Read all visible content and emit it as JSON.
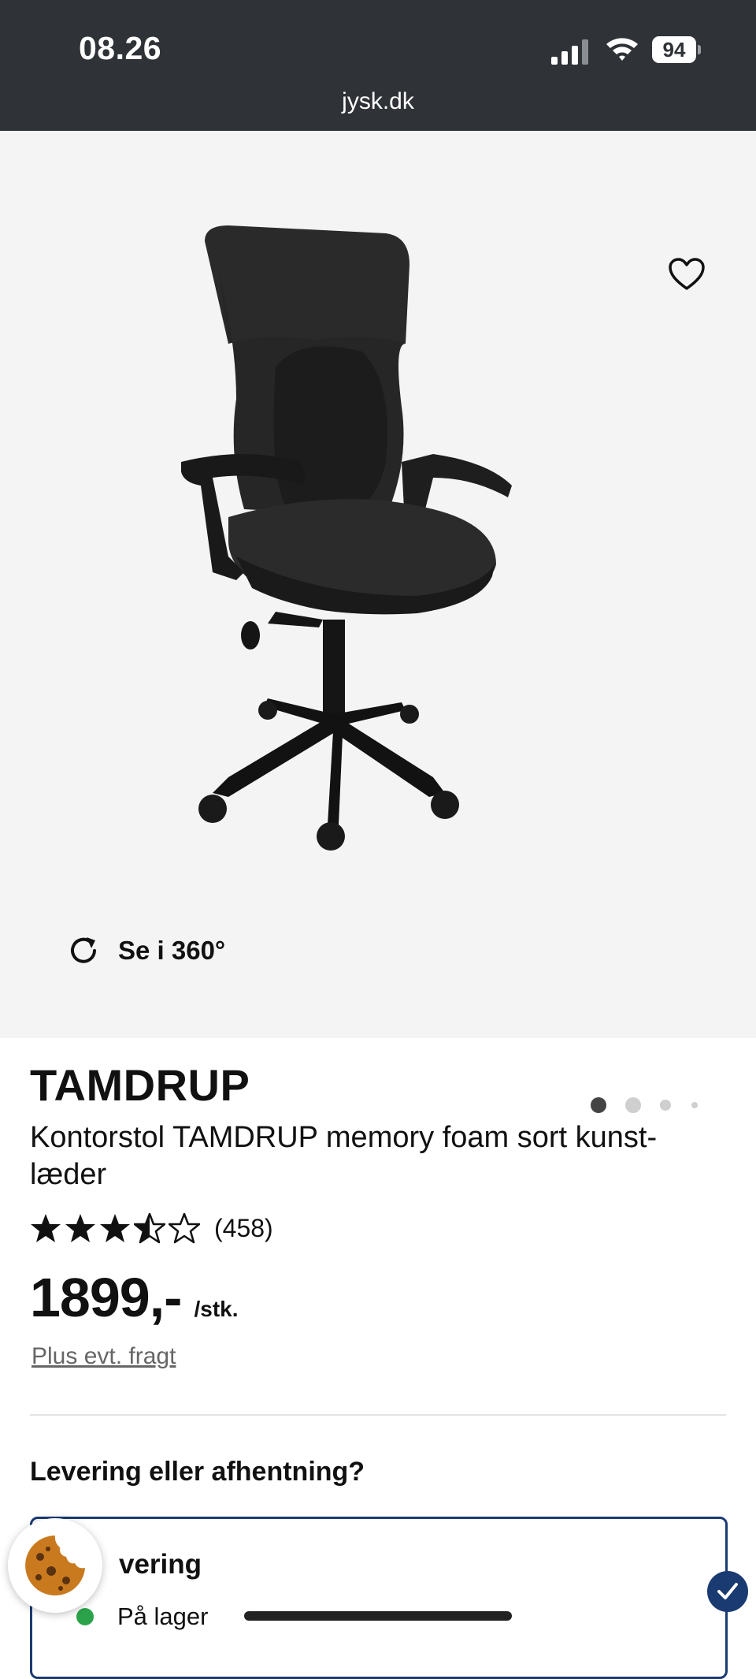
{
  "status_bar": {
    "time": "08.26",
    "battery": "94",
    "icons": [
      "cellular-signal-icon",
      "wifi-icon",
      "battery-icon"
    ]
  },
  "browser": {
    "url": "jysk.dk"
  },
  "gallery": {
    "favorite_icon": "heart-outline-icon",
    "view_360_label": "Se i 360°",
    "view_360_icon": "rotate-icon",
    "image_alt": "office-chair-product-image",
    "image_count": 4,
    "active_image": 1
  },
  "product": {
    "brand": "TAMDRUP",
    "name": "Kontorstol TAMDRUP memory foam sort kunst-læder",
    "name_line1": "Kontorstol TAMDRUP memory foam sort kunst-",
    "name_line2": "læder",
    "rating": 3.5,
    "rating_max": 5,
    "review_count": "(458)",
    "price": "1899,-",
    "price_unit": "/stk.",
    "freight_link": "Plus evt. fragt"
  },
  "delivery": {
    "question": "Levering eller afhentning?",
    "option_title_visible": "vering",
    "stock_status": "På lager",
    "selected": true
  },
  "colors": {
    "status_bar_bg": "#2f3236",
    "gallery_bg": "#f4f4f4",
    "accent_navy": "#1a3a72",
    "in_stock_green": "#2aa34a"
  },
  "overlays": {
    "cookie_icon": "cookie-icon",
    "check_icon": "checkmark-icon"
  }
}
